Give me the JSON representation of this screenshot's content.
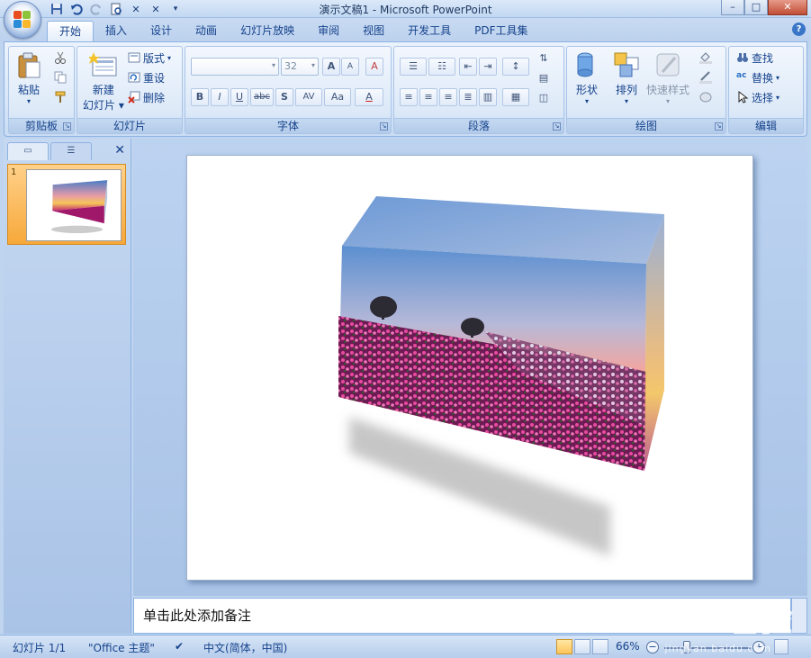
{
  "window": {
    "title": "演示文稿1 - Microsoft PowerPoint",
    "minimize": "–",
    "maximize": "□",
    "close": "✕"
  },
  "quick_access": [
    "save",
    "undo",
    "redo",
    "print-preview",
    "custom1",
    "custom2",
    "customize"
  ],
  "tabs": [
    "开始",
    "插入",
    "设计",
    "动画",
    "幻灯片放映",
    "审阅",
    "视图",
    "开发工具",
    "PDF工具集"
  ],
  "active_tab": "开始",
  "ribbon": {
    "clipboard": {
      "label": "剪贴板",
      "paste": "粘贴"
    },
    "slides": {
      "label": "幻灯片",
      "new_slide_line1": "新建",
      "new_slide_line2": "幻灯片",
      "layout": "版式",
      "reset": "重设",
      "delete": "删除"
    },
    "font": {
      "label": "字体",
      "font_name": "",
      "font_size": "32",
      "grow": "A",
      "shrink": "A",
      "clear": "A",
      "bold": "B",
      "italic": "I",
      "underline": "U",
      "strike": "abc",
      "shadow": "S",
      "spacing": "AV",
      "case": "Aa",
      "color": "A"
    },
    "paragraph": {
      "label": "段落"
    },
    "drawing": {
      "label": "绘图",
      "shapes": "形状",
      "arrange": "排列",
      "quick_styles": "快速样式"
    },
    "editing": {
      "label": "编辑",
      "find": "查找",
      "replace": "替换",
      "select": "选择"
    }
  },
  "slides_panel": {
    "slide_number": "1"
  },
  "notes": {
    "placeholder": "单击此处添加备注"
  },
  "status": {
    "slide_info": "幻灯片 1/1",
    "theme": "\"Office 主题\"",
    "language": "中文(简体，中国)",
    "zoom": "66%",
    "zoom_level": 0.66
  },
  "watermark": {
    "text": "Bai 经验",
    "sub": "jingyan.baidu.com"
  },
  "colors": {
    "ribbon_accent": "#15428b",
    "active_thumb": "#f7a83a"
  }
}
